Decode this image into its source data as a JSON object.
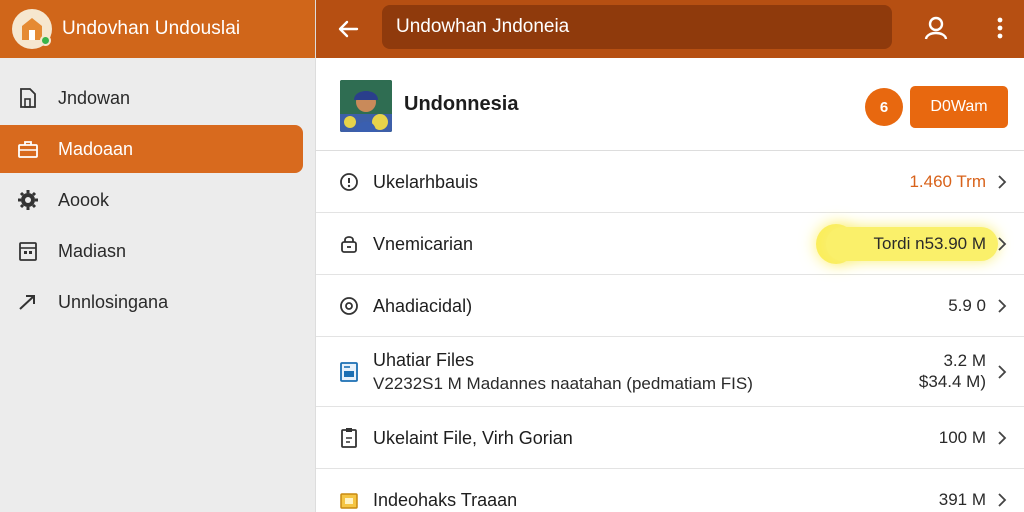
{
  "app": {
    "title": "Undovhan Undouslai"
  },
  "sidebar": {
    "items": [
      {
        "label": "Jndowan",
        "icon": "document-icon"
      },
      {
        "label": "Madoaan",
        "icon": "briefcase-icon",
        "active": true
      },
      {
        "label": "Aoook",
        "icon": "gear-icon"
      },
      {
        "label": "Madiasn",
        "icon": "calendar-icon"
      },
      {
        "label": "Unnlosingana",
        "icon": "send-icon"
      }
    ]
  },
  "toolbar": {
    "search_value": "Undowhan Jndoneia",
    "back_icon": "arrow-left-icon",
    "account_icon": "person-icon",
    "menu_icon": "more-vertical-icon"
  },
  "header": {
    "title": "Undonnesia",
    "circle_button_label": "6",
    "primary_button_label": "D0Wam"
  },
  "rows": [
    {
      "label": "Ukelarhbauis",
      "value": "1.460 Trm",
      "icon": "info-circle-icon"
    },
    {
      "label": "Vnemicarian",
      "value": "Tordi n53.90 M",
      "icon": "lock-icon",
      "highlighted": true
    },
    {
      "label": "Ahadiacidal)",
      "value": "5.9 0",
      "icon": "at-circle-icon"
    },
    {
      "label": "Uhatiar Files",
      "sub": "V2232S1 M Madannes naatahan (pedmatiam FIS)",
      "value": "3.2 M",
      "value2": "$34.4 M)",
      "icon": "file-chart-icon"
    },
    {
      "label": "Ukelaint File, Virh Gorian",
      "value": "100 M",
      "icon": "clipboard-icon"
    },
    {
      "label": "Indeohaks Traaan",
      "value": "391 M",
      "icon": "folder-icon"
    }
  ],
  "colors": {
    "accent": "#d86a1e",
    "topbar": "#b64f12",
    "search_bg": "#8f3a0c",
    "highlight": "#faf06a",
    "value_orange": "#d8621a"
  }
}
